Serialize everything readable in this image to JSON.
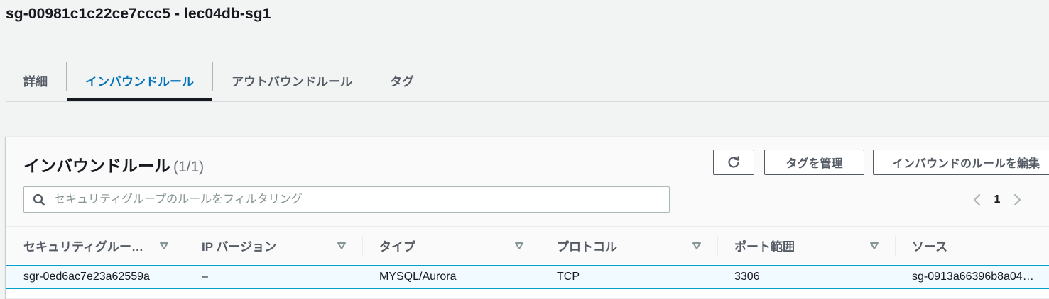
{
  "page": {
    "title": "sg-00981c1c22ce7ccc5 - lec04db-sg1"
  },
  "tabs": [
    {
      "label": "詳細"
    },
    {
      "label": "インバウンドルール"
    },
    {
      "label": "アウトバウンドルール"
    },
    {
      "label": "タグ"
    }
  ],
  "panel": {
    "title": "インバウンドルール",
    "count": "(1/1)",
    "buttons": {
      "refresh_icon": "refresh-icon",
      "manage_tags": "タグを管理",
      "edit_inbound": "インバウンドのルールを編集"
    },
    "search": {
      "placeholder": "セキュリティグループのルールをフィルタリング",
      "value": ""
    },
    "pagination": {
      "current_page": "1"
    }
  },
  "table": {
    "columns": [
      "セキュリティグループルール ID",
      "IP バージョン",
      "タイプ",
      "プロトコル",
      "ポート範囲",
      "ソース"
    ],
    "columns_display": [
      "セキュリティグルー…",
      "IP バージョン",
      "タイプ",
      "プロトコル",
      "ポート範囲",
      "ソース"
    ],
    "rows": [
      [
        "sgr-0ed6ac7e23a62559a",
        "–",
        "MYSQL/Aurora",
        "TCP",
        "3306",
        "sg-0913a66396b8a04…"
      ]
    ]
  },
  "colors": {
    "accent": "#0073bb",
    "selected_row_bg": "#f1faff",
    "selected_row_border": "#00a1c9",
    "text_primary": "#16191f",
    "text_secondary": "#545b64"
  }
}
